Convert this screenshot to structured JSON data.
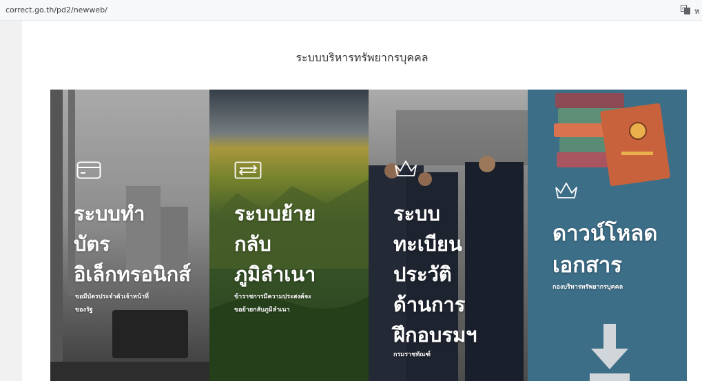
{
  "browser": {
    "url": "correct.go.th/pd2/newweb/",
    "translate_icon": "translate-icon",
    "overflow_glyph": "ห"
  },
  "page": {
    "heading": "ระบบบริหารทรัพยากรบุคคล"
  },
  "cards": [
    {
      "icon": "id-card-icon",
      "title_lines": [
        "ระบบทำ",
        "บัตร",
        "อิเล็กทรอนิกส์"
      ],
      "subtitle_lines": [
        "ขอมีบัตรประจำตัวเจ้าหน้าที่",
        "ของรัฐ"
      ]
    },
    {
      "icon": "transfer-arrows-icon",
      "title_lines": [
        "ระบบย้าย",
        "กลับ",
        "ภูมิลำเนา"
      ],
      "subtitle_lines": [
        "ข้าราชการมีความประสงค์จะ",
        "ขอย้ายกลับภูมิลำเนา"
      ]
    },
    {
      "icon": "crown-icon",
      "title_lines": [
        "ระบบ",
        "ทะเบียน",
        "ประวัติ",
        "ด้านการ",
        "ฝึกอบรมฯ"
      ],
      "subtitle_lines": [
        "กรมราชทัณฑ์"
      ]
    },
    {
      "icon": "crown-icon",
      "title_lines": [
        "ดาวน์โหลด",
        "เอกสาร"
      ],
      "subtitle_lines": [
        "กองบริหารทรัพยากรบุคคล"
      ],
      "decor_icon": "download-arrow-icon",
      "books_icon": "books-icon"
    }
  ],
  "colors": {
    "download_card": "#3d6e88",
    "text": "#ffffff"
  }
}
